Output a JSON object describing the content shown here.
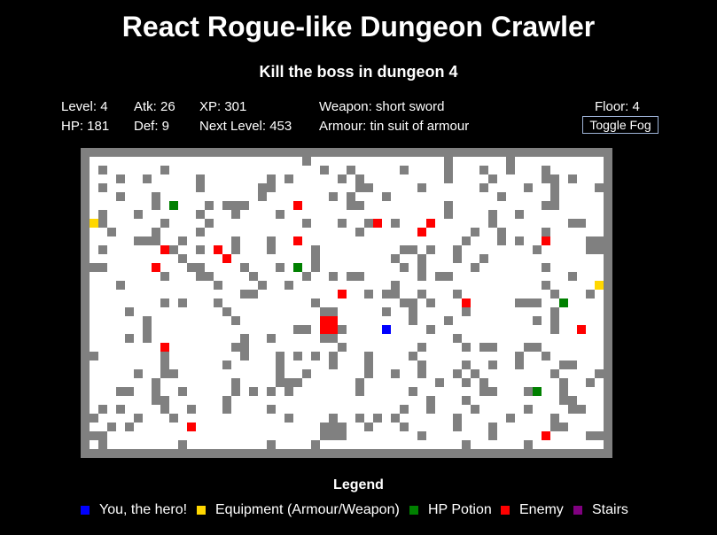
{
  "header": {
    "title": "React Rogue-like Dungeon Crawler",
    "subtitle": "Kill the boss in dungeon 4"
  },
  "stats": {
    "level": "Level: 4",
    "hp": "HP: 181",
    "atk": "Atk: 26",
    "def": "Def: 9",
    "xp": "XP: 301",
    "next_level": "Next Level: 453",
    "weapon": "Weapon: short sword",
    "armour": "Armour: tin suit of armour",
    "floor": "Floor: 4"
  },
  "controls": {
    "toggle_fog_label": "Toggle Fog"
  },
  "colors": {
    "hero": "#0000ff",
    "equipment": "#ffd700",
    "potion": "#008000",
    "enemy": "#ff0000",
    "stairs": "#800080",
    "wall": "#808080",
    "floor": "#ffffff"
  },
  "map": {
    "columns": 58,
    "rows": 33,
    "walls": [
      [
        24,
        0
      ],
      [
        40,
        0
      ],
      [
        47,
        0
      ],
      [
        1,
        1
      ],
      [
        8,
        1
      ],
      [
        26,
        1
      ],
      [
        29,
        1
      ],
      [
        35,
        1
      ],
      [
        40,
        1
      ],
      [
        44,
        1
      ],
      [
        47,
        1
      ],
      [
        51,
        1
      ],
      [
        3,
        2
      ],
      [
        6,
        2
      ],
      [
        12,
        2
      ],
      [
        20,
        2
      ],
      [
        22,
        2
      ],
      [
        28,
        2
      ],
      [
        30,
        2
      ],
      [
        40,
        2
      ],
      [
        45,
        2
      ],
      [
        51,
        2
      ],
      [
        52,
        2
      ],
      [
        54,
        2
      ],
      [
        1,
        3
      ],
      [
        12,
        3
      ],
      [
        19,
        3
      ],
      [
        20,
        3
      ],
      [
        30,
        3
      ],
      [
        31,
        3
      ],
      [
        37,
        3
      ],
      [
        44,
        3
      ],
      [
        49,
        3
      ],
      [
        52,
        3
      ],
      [
        57,
        3
      ],
      [
        3,
        4
      ],
      [
        7,
        4
      ],
      [
        19,
        4
      ],
      [
        27,
        4
      ],
      [
        29,
        4
      ],
      [
        33,
        4
      ],
      [
        46,
        4
      ],
      [
        52,
        4
      ],
      [
        7,
        5
      ],
      [
        13,
        5
      ],
      [
        15,
        5
      ],
      [
        16,
        5
      ],
      [
        17,
        5
      ],
      [
        29,
        5
      ],
      [
        30,
        5
      ],
      [
        40,
        5
      ],
      [
        51,
        5
      ],
      [
        52,
        5
      ],
      [
        1,
        6
      ],
      [
        5,
        6
      ],
      [
        12,
        6
      ],
      [
        16,
        6
      ],
      [
        21,
        6
      ],
      [
        40,
        6
      ],
      [
        45,
        6
      ],
      [
        48,
        6
      ],
      [
        1,
        7
      ],
      [
        8,
        7
      ],
      [
        13,
        7
      ],
      [
        24,
        7
      ],
      [
        28,
        7
      ],
      [
        31,
        7
      ],
      [
        34,
        7
      ],
      [
        45,
        7
      ],
      [
        54,
        7
      ],
      [
        55,
        7
      ],
      [
        2,
        8
      ],
      [
        7,
        8
      ],
      [
        12,
        8
      ],
      [
        30,
        8
      ],
      [
        43,
        8
      ],
      [
        46,
        8
      ],
      [
        51,
        8
      ],
      [
        5,
        9
      ],
      [
        6,
        9
      ],
      [
        7,
        9
      ],
      [
        10,
        9
      ],
      [
        16,
        9
      ],
      [
        20,
        9
      ],
      [
        23,
        9
      ],
      [
        42,
        9
      ],
      [
        46,
        9
      ],
      [
        48,
        9
      ],
      [
        56,
        9
      ],
      [
        57,
        9
      ],
      [
        1,
        10
      ],
      [
        9,
        10
      ],
      [
        12,
        10
      ],
      [
        16,
        10
      ],
      [
        20,
        10
      ],
      [
        25,
        10
      ],
      [
        35,
        10
      ],
      [
        36,
        10
      ],
      [
        38,
        10
      ],
      [
        41,
        10
      ],
      [
        50,
        10
      ],
      [
        56,
        10
      ],
      [
        57,
        10
      ],
      [
        10,
        11
      ],
      [
        25,
        11
      ],
      [
        34,
        11
      ],
      [
        37,
        11
      ],
      [
        41,
        11
      ],
      [
        44,
        11
      ],
      [
        0,
        12
      ],
      [
        1,
        12
      ],
      [
        11,
        12
      ],
      [
        12,
        12
      ],
      [
        17,
        12
      ],
      [
        21,
        12
      ],
      [
        25,
        12
      ],
      [
        35,
        12
      ],
      [
        37,
        12
      ],
      [
        43,
        12
      ],
      [
        51,
        12
      ],
      [
        8,
        13
      ],
      [
        12,
        13
      ],
      [
        13,
        13
      ],
      [
        18,
        13
      ],
      [
        24,
        13
      ],
      [
        27,
        13
      ],
      [
        29,
        13
      ],
      [
        30,
        13
      ],
      [
        37,
        13
      ],
      [
        39,
        13
      ],
      [
        40,
        13
      ],
      [
        54,
        13
      ],
      [
        3,
        14
      ],
      [
        14,
        14
      ],
      [
        19,
        14
      ],
      [
        22,
        14
      ],
      [
        34,
        14
      ],
      [
        51,
        14
      ],
      [
        17,
        15
      ],
      [
        18,
        15
      ],
      [
        28,
        15
      ],
      [
        31,
        15
      ],
      [
        33,
        15
      ],
      [
        34,
        15
      ],
      [
        37,
        15
      ],
      [
        41,
        15
      ],
      [
        52,
        15
      ],
      [
        56,
        15
      ],
      [
        8,
        16
      ],
      [
        10,
        16
      ],
      [
        14,
        16
      ],
      [
        25,
        16
      ],
      [
        35,
        16
      ],
      [
        36,
        16
      ],
      [
        38,
        16
      ],
      [
        48,
        16
      ],
      [
        49,
        16
      ],
      [
        50,
        16
      ],
      [
        4,
        17
      ],
      [
        15,
        17
      ],
      [
        26,
        17
      ],
      [
        27,
        17
      ],
      [
        33,
        17
      ],
      [
        36,
        17
      ],
      [
        42,
        17
      ],
      [
        52,
        17
      ],
      [
        6,
        18
      ],
      [
        16,
        18
      ],
      [
        26,
        18
      ],
      [
        27,
        18
      ],
      [
        36,
        18
      ],
      [
        40,
        18
      ],
      [
        50,
        18
      ],
      [
        52,
        18
      ],
      [
        6,
        19
      ],
      [
        23,
        19
      ],
      [
        24,
        19
      ],
      [
        28,
        19
      ],
      [
        33,
        19
      ],
      [
        38,
        19
      ],
      [
        52,
        19
      ],
      [
        4,
        20
      ],
      [
        6,
        20
      ],
      [
        17,
        20
      ],
      [
        20,
        20
      ],
      [
        26,
        20
      ],
      [
        27,
        20
      ],
      [
        41,
        20
      ],
      [
        16,
        21
      ],
      [
        17,
        21
      ],
      [
        28,
        21
      ],
      [
        37,
        21
      ],
      [
        42,
        21
      ],
      [
        44,
        21
      ],
      [
        45,
        21
      ],
      [
        49,
        21
      ],
      [
        50,
        21
      ],
      [
        0,
        22
      ],
      [
        8,
        22
      ],
      [
        17,
        22
      ],
      [
        21,
        22
      ],
      [
        23,
        22
      ],
      [
        25,
        22
      ],
      [
        27,
        22
      ],
      [
        31,
        22
      ],
      [
        36,
        22
      ],
      [
        48,
        22
      ],
      [
        51,
        22
      ],
      [
        8,
        23
      ],
      [
        15,
        23
      ],
      [
        21,
        23
      ],
      [
        27,
        23
      ],
      [
        31,
        23
      ],
      [
        37,
        23
      ],
      [
        42,
        23
      ],
      [
        45,
        23
      ],
      [
        48,
        23
      ],
      [
        53,
        23
      ],
      [
        54,
        23
      ],
      [
        5,
        24
      ],
      [
        8,
        24
      ],
      [
        9,
        24
      ],
      [
        21,
        24
      ],
      [
        24,
        24
      ],
      [
        31,
        24
      ],
      [
        34,
        24
      ],
      [
        37,
        24
      ],
      [
        41,
        24
      ],
      [
        43,
        24
      ],
      [
        52,
        24
      ],
      [
        57,
        24
      ],
      [
        7,
        25
      ],
      [
        16,
        25
      ],
      [
        21,
        25
      ],
      [
        22,
        25
      ],
      [
        23,
        25
      ],
      [
        30,
        25
      ],
      [
        39,
        25
      ],
      [
        42,
        25
      ],
      [
        44,
        25
      ],
      [
        53,
        25
      ],
      [
        56,
        25
      ],
      [
        3,
        26
      ],
      [
        4,
        26
      ],
      [
        7,
        26
      ],
      [
        10,
        26
      ],
      [
        16,
        26
      ],
      [
        18,
        26
      ],
      [
        20,
        26
      ],
      [
        22,
        26
      ],
      [
        30,
        26
      ],
      [
        36,
        26
      ],
      [
        44,
        26
      ],
      [
        45,
        26
      ],
      [
        49,
        26
      ],
      [
        50,
        26
      ],
      [
        53,
        26
      ],
      [
        7,
        27
      ],
      [
        8,
        27
      ],
      [
        15,
        27
      ],
      [
        38,
        27
      ],
      [
        42,
        27
      ],
      [
        53,
        27
      ],
      [
        54,
        27
      ],
      [
        1,
        28
      ],
      [
        3,
        28
      ],
      [
        8,
        28
      ],
      [
        11,
        28
      ],
      [
        15,
        28
      ],
      [
        20,
        28
      ],
      [
        35,
        28
      ],
      [
        38,
        28
      ],
      [
        43,
        28
      ],
      [
        49,
        28
      ],
      [
        54,
        28
      ],
      [
        55,
        28
      ],
      [
        0,
        29
      ],
      [
        5,
        29
      ],
      [
        9,
        29
      ],
      [
        22,
        29
      ],
      [
        27,
        29
      ],
      [
        30,
        29
      ],
      [
        32,
        29
      ],
      [
        34,
        29
      ],
      [
        41,
        29
      ],
      [
        47,
        29
      ],
      [
        52,
        29
      ],
      [
        2,
        30
      ],
      [
        4,
        30
      ],
      [
        26,
        30
      ],
      [
        27,
        30
      ],
      [
        28,
        30
      ],
      [
        31,
        30
      ],
      [
        35,
        30
      ],
      [
        41,
        30
      ],
      [
        45,
        30
      ],
      [
        52,
        30
      ],
      [
        53,
        30
      ],
      [
        0,
        31
      ],
      [
        1,
        31
      ],
      [
        26,
        31
      ],
      [
        27,
        31
      ],
      [
        28,
        31
      ],
      [
        37,
        31
      ],
      [
        45,
        31
      ],
      [
        56,
        31
      ],
      [
        57,
        31
      ],
      [
        1,
        32
      ],
      [
        10,
        32
      ],
      [
        20,
        32
      ],
      [
        25,
        32
      ],
      [
        42,
        32
      ],
      [
        49,
        32
      ]
    ],
    "hero": [
      [
        33,
        19
      ]
    ],
    "boss": [
      [
        26,
        18
      ]
    ],
    "equipment": [
      [
        0,
        7
      ],
      [
        57,
        14
      ]
    ],
    "potions": [
      [
        9,
        5
      ],
      [
        23,
        12
      ],
      [
        53,
        16
      ],
      [
        50,
        26
      ]
    ],
    "enemies": [
      [
        23,
        5
      ],
      [
        32,
        7
      ],
      [
        38,
        7
      ],
      [
        37,
        8
      ],
      [
        51,
        9
      ],
      [
        23,
        9
      ],
      [
        8,
        10
      ],
      [
        14,
        10
      ],
      [
        15,
        11
      ],
      [
        7,
        12
      ],
      [
        28,
        15
      ],
      [
        42,
        16
      ],
      [
        55,
        19
      ],
      [
        8,
        21
      ],
      [
        11,
        30
      ],
      [
        51,
        31
      ]
    ],
    "stairs": []
  },
  "legend": {
    "title": "Legend",
    "items": [
      {
        "label": "You, the hero!",
        "color": "#0000ff"
      },
      {
        "label": "Equipment (Armour/Weapon)",
        "color": "#ffd700"
      },
      {
        "label": "HP Potion",
        "color": "#008000"
      },
      {
        "label": "Enemy",
        "color": "#ff0000"
      },
      {
        "label": "Stairs",
        "color": "#800080"
      }
    ]
  }
}
